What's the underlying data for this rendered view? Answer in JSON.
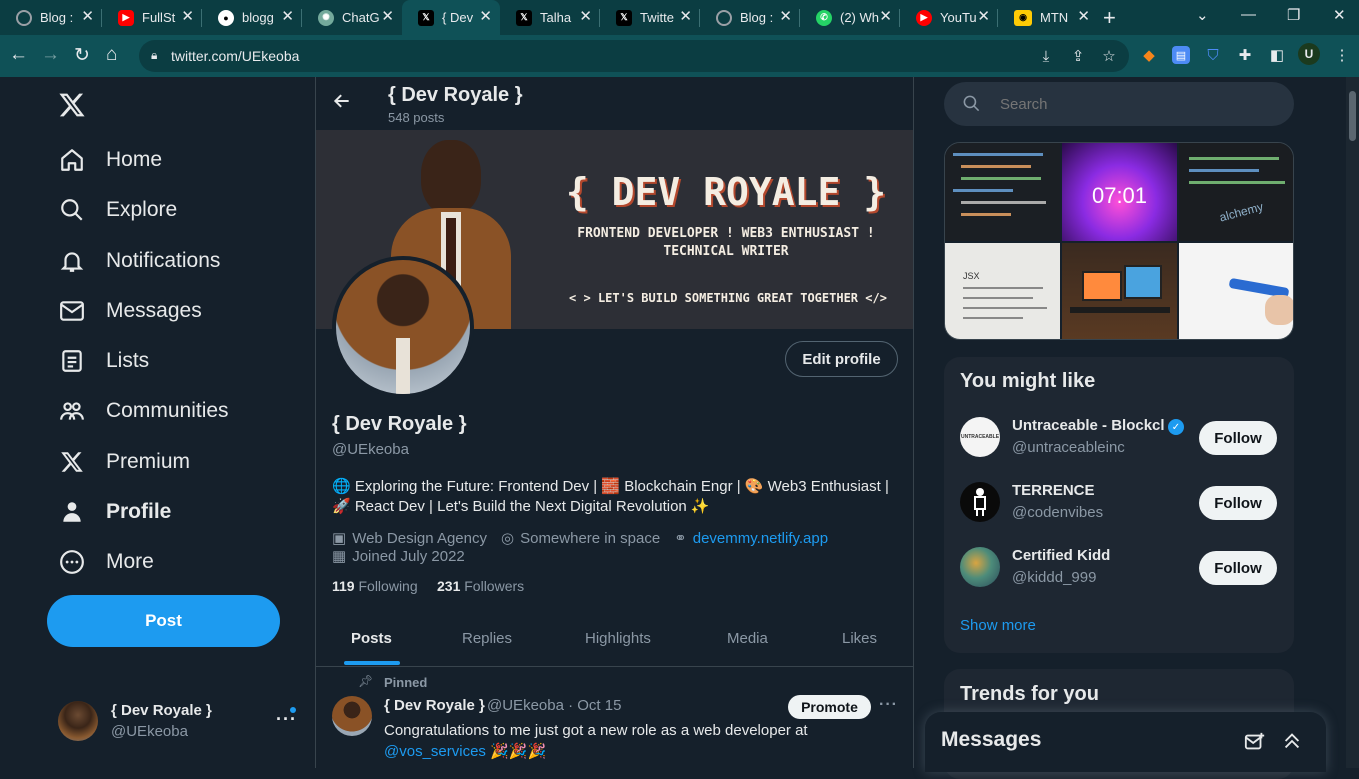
{
  "browser": {
    "tabs": [
      {
        "title": "Blog :",
        "icon": "globe-icon",
        "color": "#9aa0a6"
      },
      {
        "title": "FullSt",
        "icon": "youtube-icon",
        "color": "#ff0000"
      },
      {
        "title": "blogg",
        "icon": "github-icon",
        "color": "#ffffff"
      },
      {
        "title": "ChatG",
        "icon": "chatgpt-icon",
        "color": "#74aa9c"
      },
      {
        "title": "{ Dev",
        "icon": "x-logo-icon",
        "color": "#000000"
      },
      {
        "title": "Talha",
        "icon": "x-logo-icon",
        "color": "#000000"
      },
      {
        "title": "Twitte",
        "icon": "x-logo-icon",
        "color": "#000000"
      },
      {
        "title": "Blog :",
        "icon": "globe-icon",
        "color": "#9aa0a6"
      },
      {
        "title": "(2) Wh",
        "icon": "whatsapp-icon",
        "color": "#25d366"
      },
      {
        "title": "YouTu",
        "icon": "youtube-icon",
        "color": "#ff0000"
      },
      {
        "title": "MTN",
        "icon": "mtn-icon",
        "color": "#ffcb05"
      }
    ],
    "url": "twitter.com/UEkeoba",
    "profile_initial": "U"
  },
  "sidebar": {
    "items": [
      {
        "label": "Home",
        "icon": "home-icon"
      },
      {
        "label": "Explore",
        "icon": "search-icon"
      },
      {
        "label": "Notifications",
        "icon": "bell-icon"
      },
      {
        "label": "Messages",
        "icon": "mail-icon"
      },
      {
        "label": "Lists",
        "icon": "list-icon"
      },
      {
        "label": "Communities",
        "icon": "people-icon"
      },
      {
        "label": "Premium",
        "icon": "x-logo-icon"
      },
      {
        "label": "Profile",
        "icon": "person-icon"
      },
      {
        "label": "More",
        "icon": "more-circle-icon"
      }
    ],
    "post_label": "Post",
    "account": {
      "name": "{ Dev Royale }",
      "handle": "@UEkeoba"
    }
  },
  "profile": {
    "header_name": "{ Dev Royale }",
    "post_count": "548 posts",
    "banner": {
      "title": "{ DEV ROYALE }",
      "line1": "FRONTEND DEVELOPER ! WEB3 ENTHUSIAST !",
      "line2": "TECHNICAL WRITER",
      "tagline": "< > LET'S BUILD SOMETHING GREAT TOGETHER </>"
    },
    "edit_label": "Edit profile",
    "name": "{ Dev Royale }",
    "handle": "@UEkeoba",
    "bio1": "🌐 Exploring the Future: Frontend Dev | 🧱 Blockchain Engr | 🎨 Web3 Enthusiast |",
    "bio2": "🚀 React Dev |  Let's Build the Next Digital Revolution ✨",
    "category": "Web Design Agency",
    "location": "Somewhere in space",
    "website": "devemmy.netlify.app",
    "joined": "Joined July 2022",
    "following_count": "119",
    "following_label": "Following",
    "followers_count": "231",
    "followers_label": "Followers",
    "tabs": [
      "Posts",
      "Replies",
      "Highlights",
      "Media",
      "Likes"
    ],
    "pinned": {
      "label": "Pinned",
      "name": "{ Dev Royale }",
      "meta": "@UEkeoba · Oct 15",
      "promote": "Promote",
      "text1": "Congratulations to me just got a new role as a web developer at",
      "mention": "@vos_services",
      "emoji": " 🎉🎉🎉"
    }
  },
  "rightcol": {
    "search_placeholder": "Search",
    "media_clock": "07:01",
    "media_brand": "alchemy",
    "media_doc": "JSX",
    "you_might_like": "You might like",
    "suggestions": [
      {
        "name": "Untraceable - Blockcl",
        "handle": "@untraceableinc",
        "follow": "Follow",
        "avatar_text": "UNTRACEABLE"
      },
      {
        "name": "TERRENCE",
        "handle": "@codenvibes",
        "follow": "Follow"
      },
      {
        "name": "Certified Kidd",
        "handle": "@kiddd_999",
        "follow": "Follow"
      }
    ],
    "show_more": "Show more",
    "trends": "Trends for you",
    "messages": "Messages"
  }
}
